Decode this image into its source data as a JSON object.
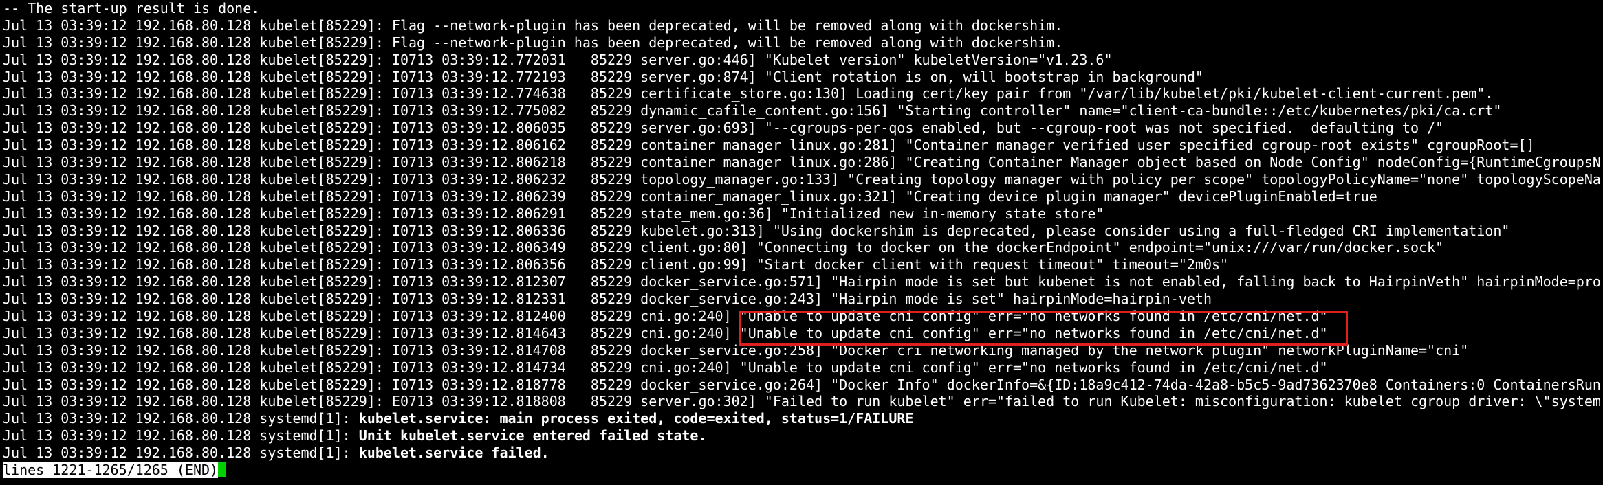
{
  "terminal": {
    "lines": [
      {
        "text": "-- The start-up result is done.",
        "bold": false
      },
      {
        "text": "Jul 13 03:39:12 192.168.80.128 kubelet[85229]: Flag --network-plugin has been deprecated, will be removed along with dockershim.",
        "bold": false
      },
      {
        "text": "Jul 13 03:39:12 192.168.80.128 kubelet[85229]: Flag --network-plugin has been deprecated, will be removed along with dockershim.",
        "bold": false
      },
      {
        "text": "Jul 13 03:39:12 192.168.80.128 kubelet[85229]: I0713 03:39:12.772031   85229 server.go:446] \"Kubelet version\" kubeletVersion=\"v1.23.6\"",
        "bold": false
      },
      {
        "text": "Jul 13 03:39:12 192.168.80.128 kubelet[85229]: I0713 03:39:12.772193   85229 server.go:874] \"Client rotation is on, will bootstrap in background\"",
        "bold": false
      },
      {
        "text": "Jul 13 03:39:12 192.168.80.128 kubelet[85229]: I0713 03:39:12.774638   85229 certificate_store.go:130] Loading cert/key pair from \"/var/lib/kubelet/pki/kubelet-client-current.pem\".",
        "bold": false
      },
      {
        "text": "Jul 13 03:39:12 192.168.80.128 kubelet[85229]: I0713 03:39:12.775082   85229 dynamic_cafile_content.go:156] \"Starting controller\" name=\"client-ca-bundle::/etc/kubernetes/pki/ca.crt\"",
        "bold": false
      },
      {
        "text": "Jul 13 03:39:12 192.168.80.128 kubelet[85229]: I0713 03:39:12.806035   85229 server.go:693] \"--cgroups-per-qos enabled, but --cgroup-root was not specified.  defaulting to /\"",
        "bold": false
      },
      {
        "text": "Jul 13 03:39:12 192.168.80.128 kubelet[85229]: I0713 03:39:12.806162   85229 container_manager_linux.go:281] \"Container manager verified user specified cgroup-root exists\" cgroupRoot=[]",
        "bold": false
      },
      {
        "text": "Jul 13 03:39:12 192.168.80.128 kubelet[85229]: I0713 03:39:12.806218   85229 container_manager_linux.go:286] \"Creating Container Manager object based on Node Config\" nodeConfig={RuntimeCgroupsN",
        "bold": false
      },
      {
        "text": "Jul 13 03:39:12 192.168.80.128 kubelet[85229]: I0713 03:39:12.806232   85229 topology_manager.go:133] \"Creating topology manager with policy per scope\" topologyPolicyName=\"none\" topologyScopeNa",
        "bold": false
      },
      {
        "text": "Jul 13 03:39:12 192.168.80.128 kubelet[85229]: I0713 03:39:12.806239   85229 container_manager_linux.go:321] \"Creating device plugin manager\" devicePluginEnabled=true",
        "bold": false
      },
      {
        "text": "Jul 13 03:39:12 192.168.80.128 kubelet[85229]: I0713 03:39:12.806291   85229 state_mem.go:36] \"Initialized new in-memory state store\"",
        "bold": false
      },
      {
        "text": "Jul 13 03:39:12 192.168.80.128 kubelet[85229]: I0713 03:39:12.806336   85229 kubelet.go:313] \"Using dockershim is deprecated, please consider using a full-fledged CRI implementation\"",
        "bold": false
      },
      {
        "text": "Jul 13 03:39:12 192.168.80.128 kubelet[85229]: I0713 03:39:12.806349   85229 client.go:80] \"Connecting to docker on the dockerEndpoint\" endpoint=\"unix:///var/run/docker.sock\"",
        "bold": false
      },
      {
        "text": "Jul 13 03:39:12 192.168.80.128 kubelet[85229]: I0713 03:39:12.806356   85229 client.go:99] \"Start docker client with request timeout\" timeout=\"2m0s\"",
        "bold": false
      },
      {
        "text": "Jul 13 03:39:12 192.168.80.128 kubelet[85229]: I0713 03:39:12.812307   85229 docker_service.go:571] \"Hairpin mode is set but kubenet is not enabled, falling back to HairpinVeth\" hairpinMode=pro",
        "bold": false
      },
      {
        "text": "Jul 13 03:39:12 192.168.80.128 kubelet[85229]: I0713 03:39:12.812331   85229 docker_service.go:243] \"Hairpin mode is set\" hairpinMode=hairpin-veth",
        "bold": false
      },
      {
        "text": "Jul 13 03:39:12 192.168.80.128 kubelet[85229]: I0713 03:39:12.812400   85229 cni.go:240] \"Unable to update cni config\" err=\"no networks found in /etc/cni/net.d\"",
        "bold": false
      },
      {
        "text": "Jul 13 03:39:12 192.168.80.128 kubelet[85229]: I0713 03:39:12.814643   85229 cni.go:240] \"Unable to update cni config\" err=\"no networks found in /etc/cni/net.d\"",
        "bold": false
      },
      {
        "text": "Jul 13 03:39:12 192.168.80.128 kubelet[85229]: I0713 03:39:12.814708   85229 docker_service.go:258] \"Docker cri networking managed by the network plugin\" networkPluginName=\"cni\"",
        "bold": false
      },
      {
        "text": "Jul 13 03:39:12 192.168.80.128 kubelet[85229]: I0713 03:39:12.814734   85229 cni.go:240] \"Unable to update cni config\" err=\"no networks found in /etc/cni/net.d\"",
        "bold": false
      },
      {
        "text": "Jul 13 03:39:12 192.168.80.128 kubelet[85229]: I0713 03:39:12.818778   85229 docker_service.go:264] \"Docker Info\" dockerInfo=&{ID:18a9c412-74da-42a8-b5c5-9ad7362370e8 Containers:0 ContainersRun",
        "bold": false
      },
      {
        "text": "Jul 13 03:39:12 192.168.80.128 kubelet[85229]: E0713 03:39:12.818808   85229 server.go:302] \"Failed to run kubelet\" err=\"failed to run Kubelet: misconfiguration: kubelet cgroup driver: \\\"system",
        "bold": false
      }
    ],
    "systemd_lines": [
      {
        "prefix": "Jul 13 03:39:12 192.168.80.128 systemd[1]: ",
        "message": "kubelet.service: main process exited, code=exited, status=1/FAILURE"
      },
      {
        "prefix": "Jul 13 03:39:12 192.168.80.128 systemd[1]: ",
        "message": "Unit kubelet.service entered failed state."
      },
      {
        "prefix": "Jul 13 03:39:12 192.168.80.128 systemd[1]: ",
        "message": "kubelet.service failed."
      }
    ],
    "status": "lines 1221-1265/1265 (END)"
  },
  "colors": {
    "background": "#000000",
    "foreground": "#ffffff",
    "cursor": "#00d000",
    "highlight_box": "#e02020"
  }
}
